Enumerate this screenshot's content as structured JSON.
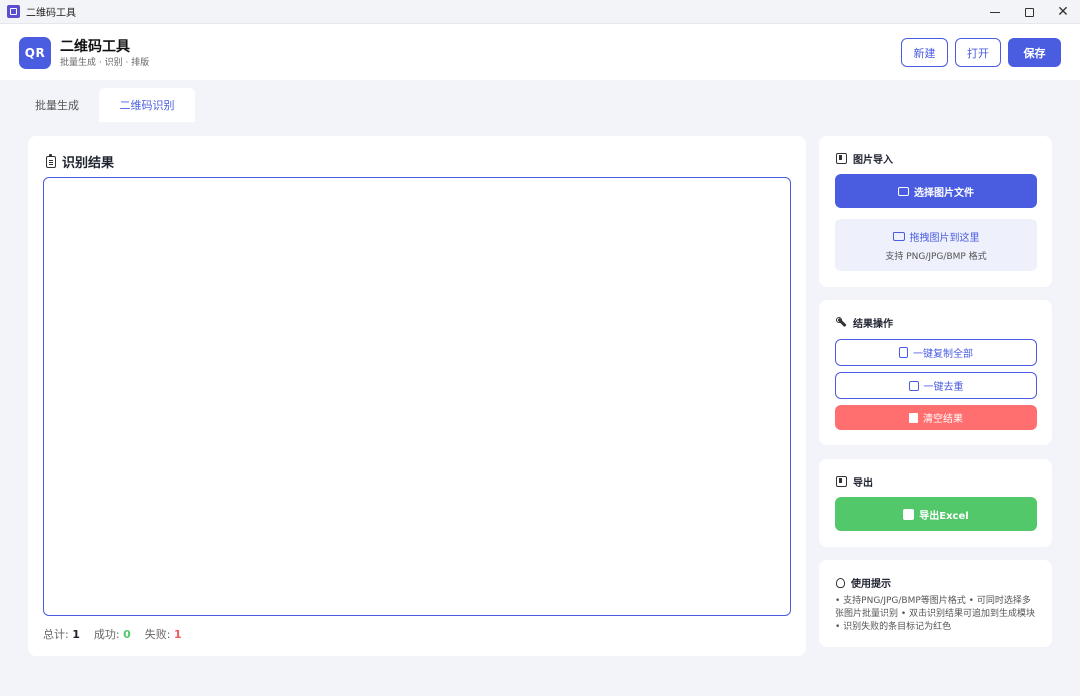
{
  "window": {
    "title": "二维码工具",
    "controls": {
      "minimize": "—",
      "maximize": "□",
      "close": "✕"
    }
  },
  "header": {
    "logo": "QR",
    "title": "二维码工具",
    "subtitle": "批量生成 · 识别 · 排版",
    "buttons": {
      "new": "新建",
      "open": "打开",
      "save": "保存"
    }
  },
  "tabs": [
    {
      "label": "批量生成",
      "active": false
    },
    {
      "label": "二维码识别",
      "active": true
    }
  ],
  "results": {
    "title": "识别结果",
    "textarea_value": "",
    "stats": {
      "total_label": "总计:",
      "total_value": "1",
      "success_label": "成功:",
      "success_value": "0",
      "fail_label": "失败:",
      "fail_value": "1"
    }
  },
  "import": {
    "title": "图片导入",
    "select_button": "选择图片文件",
    "drop_text": "拖拽图片到这里",
    "drop_hint": "支持 PNG/JPG/BMP 格式"
  },
  "operations": {
    "title": "结果操作",
    "copy_all": "一键复制全部",
    "dedupe": "一键去重",
    "clear": "清空结果"
  },
  "export": {
    "title": "导出",
    "excel_button": "导出Excel"
  },
  "tips": {
    "title": "使用提示",
    "text": "• 支持PNG/JPG/BMP等图片格式 • 可同时选择多张图片批量识别 • 双击识别结果可追加到生成模块 • 识别失败的条目标记为红色"
  },
  "colors": {
    "accent": "#4a5de0",
    "success": "#52c86a",
    "danger": "#ff6f6f",
    "fail_text": "#ef5b5b"
  }
}
